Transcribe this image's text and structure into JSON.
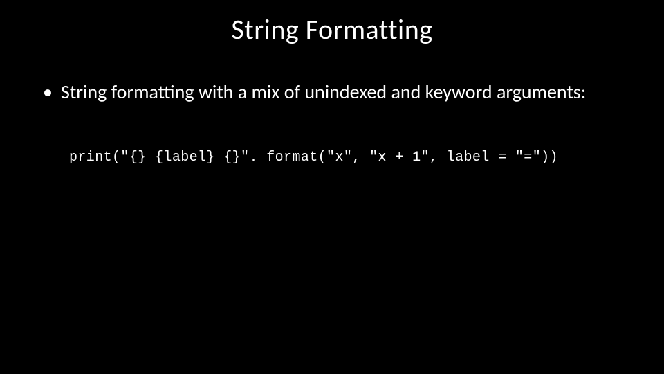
{
  "slide": {
    "title": "String Formatting",
    "bullet_marker": "•",
    "bullet_text": "String formatting with a mix of unindexed and keyword arguments:",
    "code_line": "print(\"{} {label} {}\". format(\"x\", \"x + 1\", label = \"=\"))"
  }
}
